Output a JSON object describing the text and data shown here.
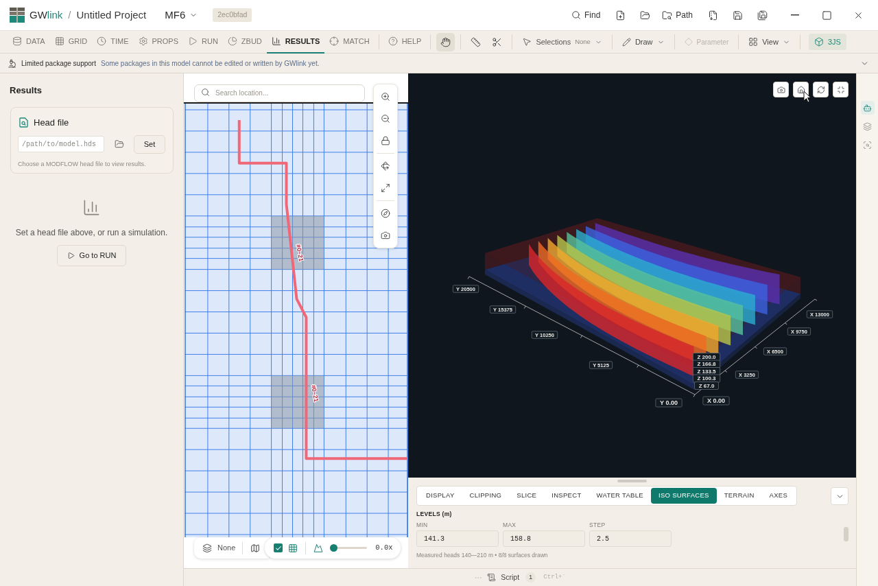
{
  "title_bar": {
    "app_name_parts": [
      "GW",
      "link"
    ],
    "separator": "/",
    "project": "Untitled Project",
    "model": "MF6",
    "commit": "2ec0bfad",
    "find_button": "Find",
    "path_button": "Path"
  },
  "nav_tabs": [
    {
      "label": "DATA",
      "selected": false
    },
    {
      "label": "GRID",
      "selected": false
    },
    {
      "label": "TIME",
      "selected": false
    },
    {
      "label": "PROPS",
      "selected": false
    },
    {
      "label": "RUN",
      "selected": false
    },
    {
      "label": "ZBUD",
      "selected": false
    },
    {
      "label": "RESULTS",
      "selected": true
    },
    {
      "label": "MATCH",
      "selected": false
    },
    {
      "label": "HELP",
      "selected": false
    }
  ],
  "tools": [
    {
      "selected": true
    },
    {
      "selected": false
    },
    {
      "selected": false
    }
  ],
  "selections": {
    "label": "Selections",
    "value": "None"
  },
  "draw": {
    "label": "Draw"
  },
  "parameter": {
    "label": "Parameter",
    "disabled": true
  },
  "view": {
    "label": "View"
  },
  "renderer": {
    "label": "3JS",
    "selected": true
  },
  "notice": {
    "title": "Limited package support",
    "message": "Some packages in this model cannot be edited or written by GWlink yet."
  },
  "results_panel": {
    "title": "Results",
    "head_file": {
      "title": "Head file",
      "placeholder": "/path/to/model.hds",
      "button": "Set",
      "hint": "Choose a MODFLOW head file to view results."
    },
    "empty_state": {
      "message": "Set a head file above, or run a simulation.",
      "button": "Go to RUN"
    }
  },
  "map": {
    "search": {
      "placeholder": "Search location..."
    },
    "boundary_labels": [
      "#0–21",
      "#0–21"
    ],
    "basemap": "None",
    "show_grid": {
      "checked": true
    },
    "exaggeration": {
      "level": 0,
      "reading": "0.0x"
    }
  },
  "viewer": {
    "y_ticks": [
      "Y 20500",
      "Y 15375",
      "Y 10250",
      "Y 5125",
      "Y 0.00"
    ],
    "x_ticks": [
      "X 0.00",
      "X 3250",
      "X 6500",
      "X 9750",
      "X 13000"
    ],
    "z_ticks": [
      "Z 200.0",
      "Z 166.8",
      "Z 133.5",
      "Z 100.3",
      "Z 67.0"
    ]
  },
  "viewer_panel": {
    "tabs": [
      {
        "label": "DISPLAY",
        "selected": false
      },
      {
        "label": "CLIPPING",
        "selected": false
      },
      {
        "label": "SLICE",
        "selected": false
      },
      {
        "label": "INSPECT",
        "selected": false
      },
      {
        "label": "WATER TABLE",
        "selected": false
      },
      {
        "label": "ISO SURFACES",
        "selected": true
      },
      {
        "label": "TERRAIN",
        "selected": false
      },
      {
        "label": "AXES",
        "selected": false
      }
    ],
    "section_title": "LEVELS (m)",
    "fields": [
      {
        "label": "MIN",
        "value": "141.3"
      },
      {
        "label": "MAX",
        "value": "158.8"
      },
      {
        "label": "STEP",
        "value": "2.5"
      }
    ],
    "summary": "Measured heads 140—210 m • 8/8 surfaces drawn"
  },
  "status_bar": {
    "label": "Script",
    "count": "1",
    "shortcut": "Ctrl+`"
  },
  "side_tools": [
    {
      "selected": true
    },
    {
      "selected": false
    },
    {
      "selected": false
    }
  ]
}
